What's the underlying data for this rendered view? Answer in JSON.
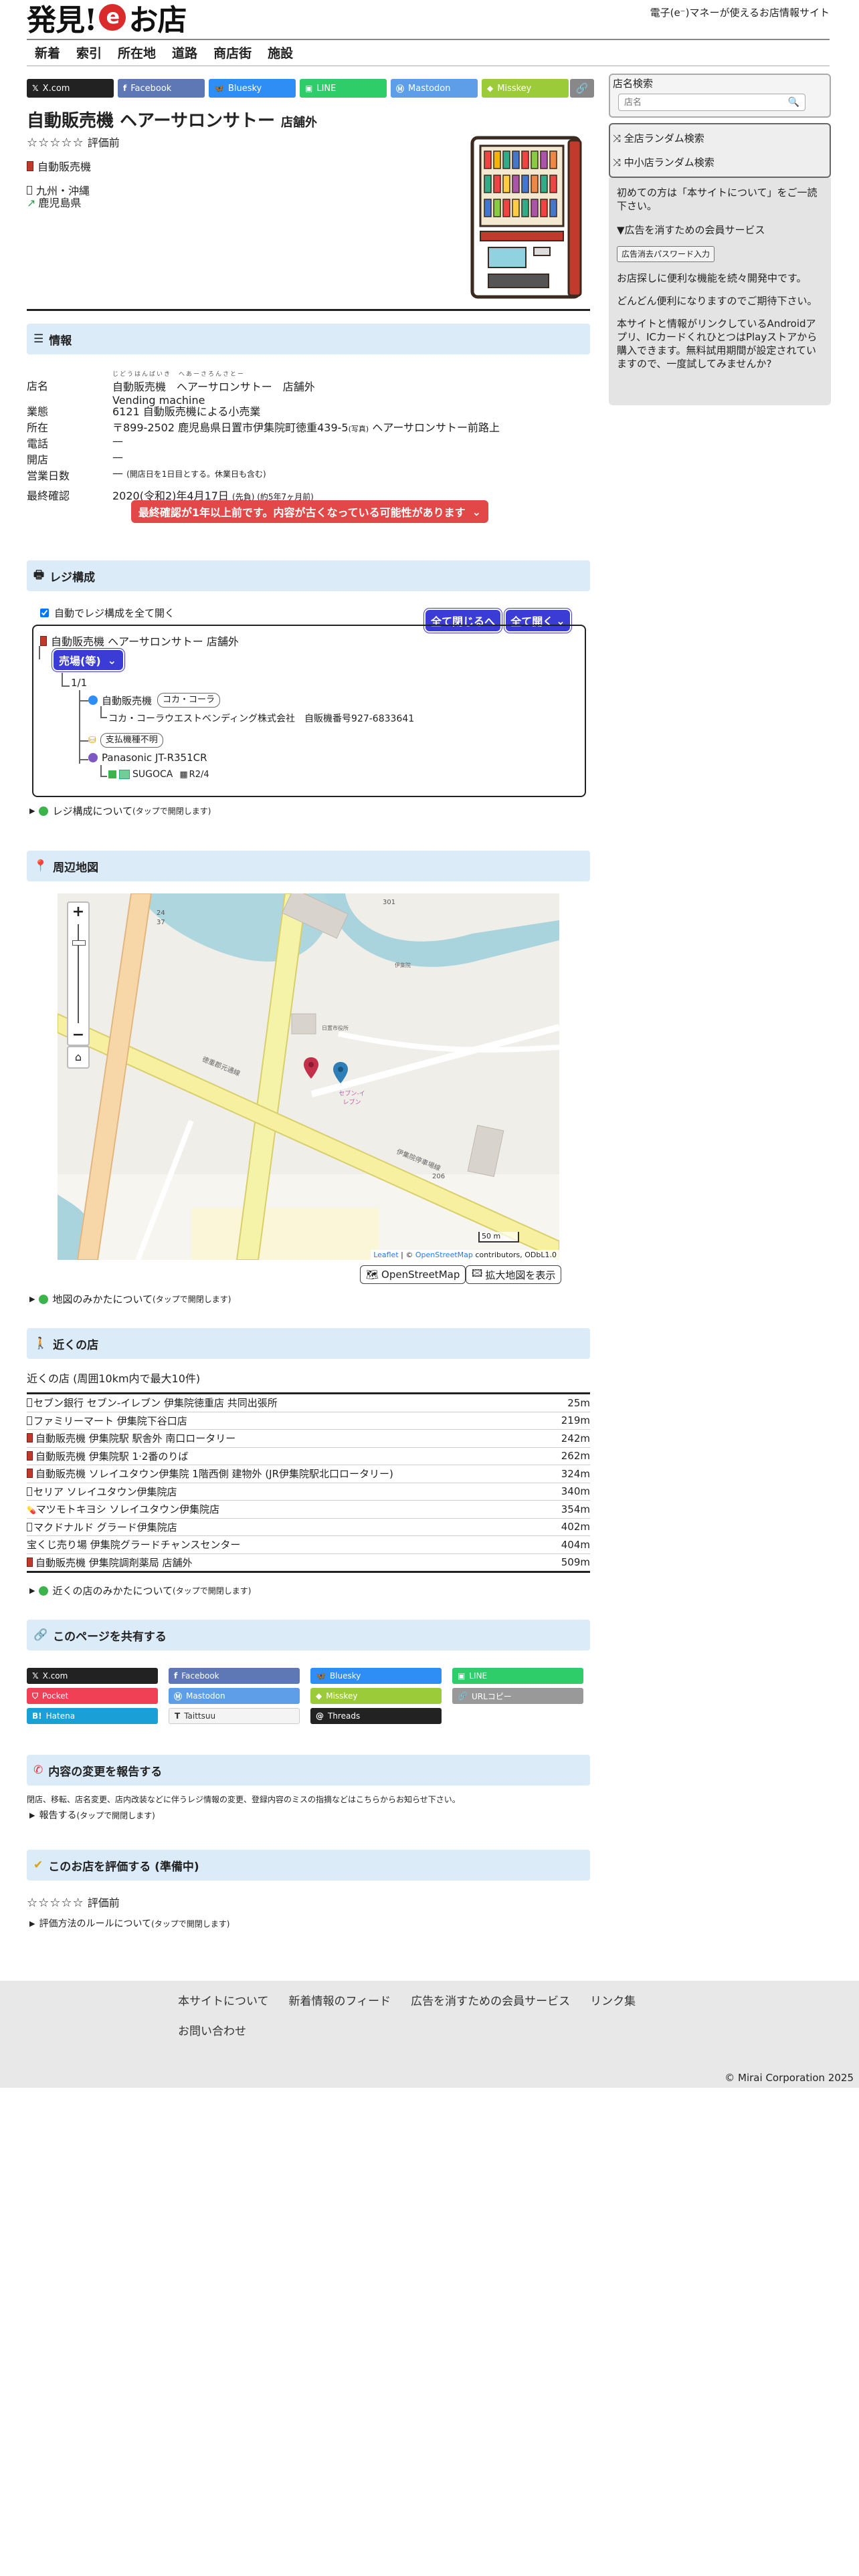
{
  "header": {
    "logo_pre": "発見!",
    "logo_e": "e",
    "logo_post": "お店",
    "tagline": "電子(e⁻)マネーが使えるお店情報サイト"
  },
  "nav": [
    "新着",
    "索引",
    "所在地",
    "道路",
    "商店街",
    "施設"
  ],
  "share_top": [
    {
      "label": "X.com",
      "color": "#222222",
      "icon": "x-icon"
    },
    {
      "label": "Facebook",
      "color": "#5d78b4",
      "icon": "facebook-icon"
    },
    {
      "label": "Bluesky",
      "color": "#2f8ef5",
      "icon": "bluesky-icon"
    },
    {
      "label": "LINE",
      "color": "#2fcc6a",
      "icon": "line-icon"
    },
    {
      "label": "Mastodon",
      "color": "#5e9ee8",
      "icon": "mastodon-icon"
    },
    {
      "label": "Misskey",
      "color": "#9ccb3a",
      "icon": "misskey-icon"
    }
  ],
  "store": {
    "title": "自動販売機 ヘアーサロンサトー",
    "title_suffix": "店舗外",
    "rating": "☆☆☆☆☆",
    "rating_label": "評価前",
    "category": "自動販売機",
    "region": "九州・沖縄",
    "prefecture": "鹿児島県"
  },
  "sections": {
    "info": "情報",
    "register": "レジ構成",
    "map": "周辺地図",
    "nearby": "近くの店",
    "share": "このページを共有する",
    "report": "内容の変更を報告する",
    "review": "このお店を評価する (準備中)"
  },
  "info": {
    "name_k": "店名",
    "name_ruby": "じどうはんばいき　へあーさろんさとー",
    "name_v": "自動販売機　ヘアーサロンサトー　店舗外",
    "name_en": "Vending machine",
    "biz_k": "業態",
    "biz_v": "6121 自動販売機による小売業",
    "addr_k": "所在",
    "addr_v": "〒899-2502 鹿児島県日置市伊集院町徳重439-5",
    "addr_note": "(写真)",
    "addr_v2": "ヘアーサロンサトー前路上",
    "tel_k": "電話",
    "tel_v": "—",
    "open_k": "開店",
    "open_v": "—",
    "days_k": "営業日数",
    "days_v": "—",
    "days_note": "(開店日を1日目とする。休業日も含む)",
    "confirm_k": "最終確認",
    "confirm_v": "2020(令和2)年4月17日",
    "confirm_note": "(先負) (約5年7ヶ月前)",
    "warning": "最終確認が1年以上前です。内容が古くなっている可能性があります"
  },
  "register": {
    "auto_open": "自動でレジ構成を全て開く",
    "close_all": "全て閉じるへ",
    "open_all": "全て開く",
    "store_name": "自動販売機 ヘアーサロンサトー 店舗外",
    "area": "売場(等)",
    "count": "1/1",
    "machine": "自動販売機",
    "brand_tag": "コカ・コーラ",
    "operator": "コカ・コーラウエストベンディング株式会社",
    "operator_reg": "自販機番号927-6833641",
    "payment_tag": "支払機種不明",
    "terminal": "Panasonic JT-R351CR",
    "suica": "SUGOCA",
    "suica_date": "R2/4",
    "about": "レジ構成について",
    "tap": "(タップで開閉します)"
  },
  "map": {
    "zoom_in": "+",
    "zoom_out": "−",
    "labels": {
      "seven": "セブン-イレブン",
      "road_a": "徳重郡元通線",
      "road_b": "伊集院停車場線",
      "route": "206",
      "route_301": "301",
      "r24": "24",
      "r37": "37",
      "r206b": "206",
      "ijuin": "日置市役所",
      "nanohana": "伊集院"
    },
    "scale": "50 m",
    "attribution_leaflet": "Leaflet",
    "attribution_osm": "OpenStreetMap",
    "attribution_rest": "contributors, ODbL1.0",
    "btn_osm": "OpenStreetMap",
    "btn_enlarge": "拡大地図を表示",
    "about": "地図のみかたについて",
    "tap": "(タップで開閉します)"
  },
  "nearby": {
    "desc": "近くの店 (周囲10km内で最大10件)",
    "rows": [
      {
        "name": "セブン銀行 セブン-イレブン 伊集院徳重店 共同出張所",
        "dist": "25m"
      },
      {
        "name": "ファミリーマート 伊集院下谷口店",
        "dist": "219m"
      },
      {
        "name": "自動販売機 伊集院駅 駅舎外 南口ロータリー",
        "dist": "242m"
      },
      {
        "name": "自動販売機 伊集院駅 1·2番のりば",
        "dist": "262m"
      },
      {
        "name": "自動販売機 ソレイユタウン伊集院 1階西側 建物外 (JR伊集院駅北口ロータリー)",
        "dist": "324m"
      },
      {
        "name": "セリア ソレイユタウン伊集院店",
        "dist": "340m"
      },
      {
        "name": "マツモトキヨシ ソレイユタウン伊集院店",
        "dist": "354m"
      },
      {
        "name": "マクドナルド グラード伊集院店",
        "dist": "402m"
      },
      {
        "name": "宝くじ売り場 伊集院グラードチャンスセンター",
        "dist": "404m"
      },
      {
        "name": "自動販売機 伊集院調剤薬局 店舗外",
        "dist": "509m"
      }
    ],
    "about": "近くの店のみかたについて",
    "tap": "(タップで開閉します)"
  },
  "share_grid": [
    {
      "label": "X.com",
      "color": "#222222",
      "fg": "#ffffff",
      "icon": "x-icon"
    },
    {
      "label": "Facebook",
      "color": "#5d78b4",
      "fg": "#ffffff",
      "icon": "facebook-icon"
    },
    {
      "label": "Bluesky",
      "color": "#2f8ef5",
      "fg": "#ffffff",
      "icon": "bluesky-icon"
    },
    {
      "label": "LINE",
      "color": "#2fcc6a",
      "fg": "#ffffff",
      "icon": "line-icon"
    },
    {
      "label": "Pocket",
      "color": "#ef4056",
      "fg": "#ffffff",
      "icon": "pocket-icon"
    },
    {
      "label": "Mastodon",
      "color": "#5e9ee8",
      "fg": "#ffffff",
      "icon": "mastodon-icon"
    },
    {
      "label": "Misskey",
      "color": "#9ccb3a",
      "fg": "#ffffff",
      "icon": "misskey-icon"
    },
    {
      "label": "URLコピー",
      "color": "#999999",
      "fg": "#ffffff",
      "icon": "link-icon"
    },
    {
      "label": "Hatena",
      "color": "#1aa0d6",
      "fg": "#ffffff",
      "icon": "hatena-icon"
    },
    {
      "label": "Taittsuu",
      "color": "#f4f4f4",
      "fg": "#333333",
      "icon": "taittsuu-icon"
    },
    {
      "label": "Threads",
      "color": "#222222",
      "fg": "#ffffff",
      "icon": "threads-icon"
    }
  ],
  "report": {
    "desc": "閉店、移転、店名変更、店内改装などに伴うレジ情報の変更、登録内容のミスの指摘などはこちらからお知らせ下さい。",
    "toggle": "報告する",
    "tap": "(タップで開閉します)"
  },
  "review": {
    "stars": "☆☆☆☆☆",
    "label": "評価前",
    "rule": "評価方法のルールについて",
    "tap": "(タップで開閉します)"
  },
  "sidebar": {
    "search_title": "店名検索",
    "search_placeholder": "店名",
    "random_all": "全店ランダム検索",
    "random_small": "中小店ランダム検索",
    "first_time": "初めての方は「本サイトについて」をご一読下さい。",
    "ad_free": "▼広告を消すための会員サービス",
    "ad_pw_btn": "広告消去パスワード入力",
    "p1": "お店探しに便利な機能を続々開発中です。",
    "p2": "どんどん便利になりますのでご期待下さい。",
    "p3": "本サイトと情報がリンクしているAndroidアプリ、ICカードくれひとつはPlayストアから購入できます。無料試用期間が設定されていますので、一度試してみませんか?"
  },
  "footer": {
    "links": [
      "本サイトについて",
      "新着情報のフィード",
      "広告を消すための会員サービス",
      "リンク集",
      "お問い合わせ"
    ],
    "copyright": "© Mirai Corporation 2025"
  }
}
